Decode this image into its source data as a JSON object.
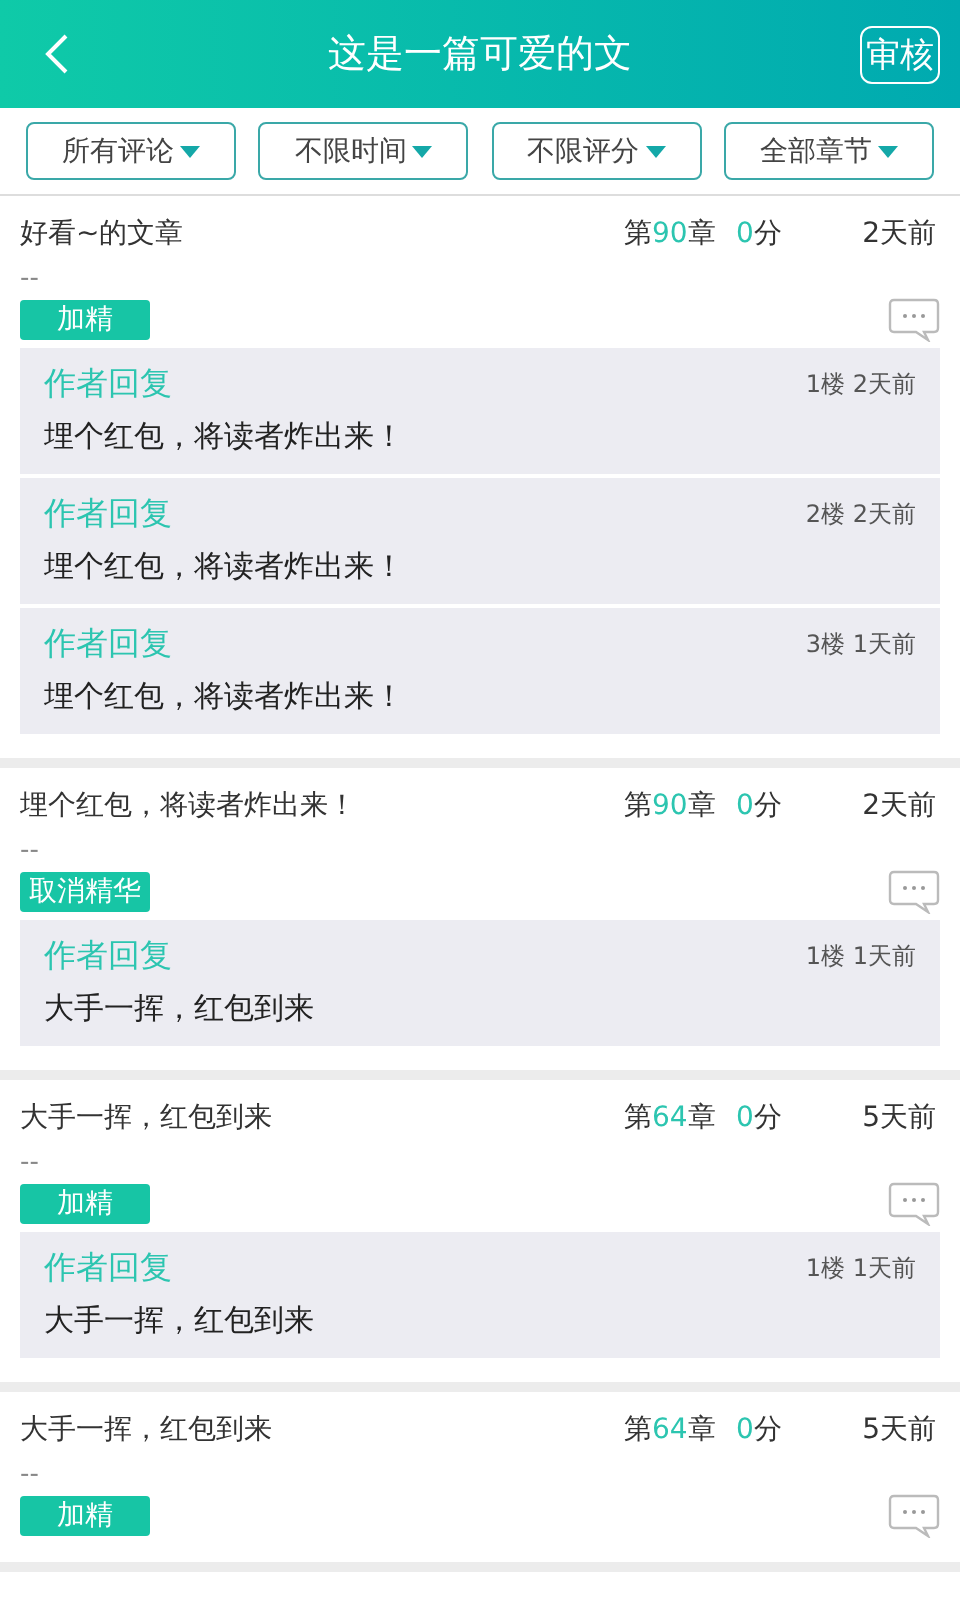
{
  "header": {
    "title": "这是一篇可爱的文",
    "action": "审核"
  },
  "filters": [
    {
      "label": "所有评论"
    },
    {
      "label": "不限时间"
    },
    {
      "label": "不限评分"
    },
    {
      "label": "全部章节"
    }
  ],
  "comments": [
    {
      "text": "好看~的文章",
      "chapter": {
        "prefix": "第",
        "number": "90",
        "suffix": "章"
      },
      "score": {
        "number": "0",
        "unit": "分"
      },
      "time": "2天前",
      "body": "--",
      "tag": "加精",
      "replies": [
        {
          "author": "作者回复",
          "meta": "1楼 2天前",
          "text": "埋个红包，将读者炸出来！"
        },
        {
          "author": "作者回复",
          "meta": "2楼 2天前",
          "text": "埋个红包，将读者炸出来！"
        },
        {
          "author": "作者回复",
          "meta": "3楼 1天前",
          "text": "埋个红包，将读者炸出来！"
        }
      ]
    },
    {
      "text": "埋个红包，将读者炸出来！",
      "chapter": {
        "prefix": "第",
        "number": "90",
        "suffix": "章"
      },
      "score": {
        "number": "0",
        "unit": "分"
      },
      "time": "2天前",
      "body": "--",
      "tag": "取消精华",
      "replies": [
        {
          "author": "作者回复",
          "meta": "1楼 1天前",
          "text": "大手一挥，红包到来"
        }
      ]
    },
    {
      "text": "大手一挥，红包到来",
      "chapter": {
        "prefix": "第",
        "number": "64",
        "suffix": "章"
      },
      "score": {
        "number": "0",
        "unit": "分"
      },
      "time": "5天前",
      "body": "--",
      "tag": "加精",
      "replies": [
        {
          "author": "作者回复",
          "meta": "1楼 1天前",
          "text": "大手一挥，红包到来"
        }
      ]
    },
    {
      "text": "大手一挥，红包到来",
      "chapter": {
        "prefix": "第",
        "number": "64",
        "suffix": "章"
      },
      "score": {
        "number": "0",
        "unit": "分"
      },
      "time": "5天前",
      "body": "--",
      "tag": "加精"
    }
  ]
}
